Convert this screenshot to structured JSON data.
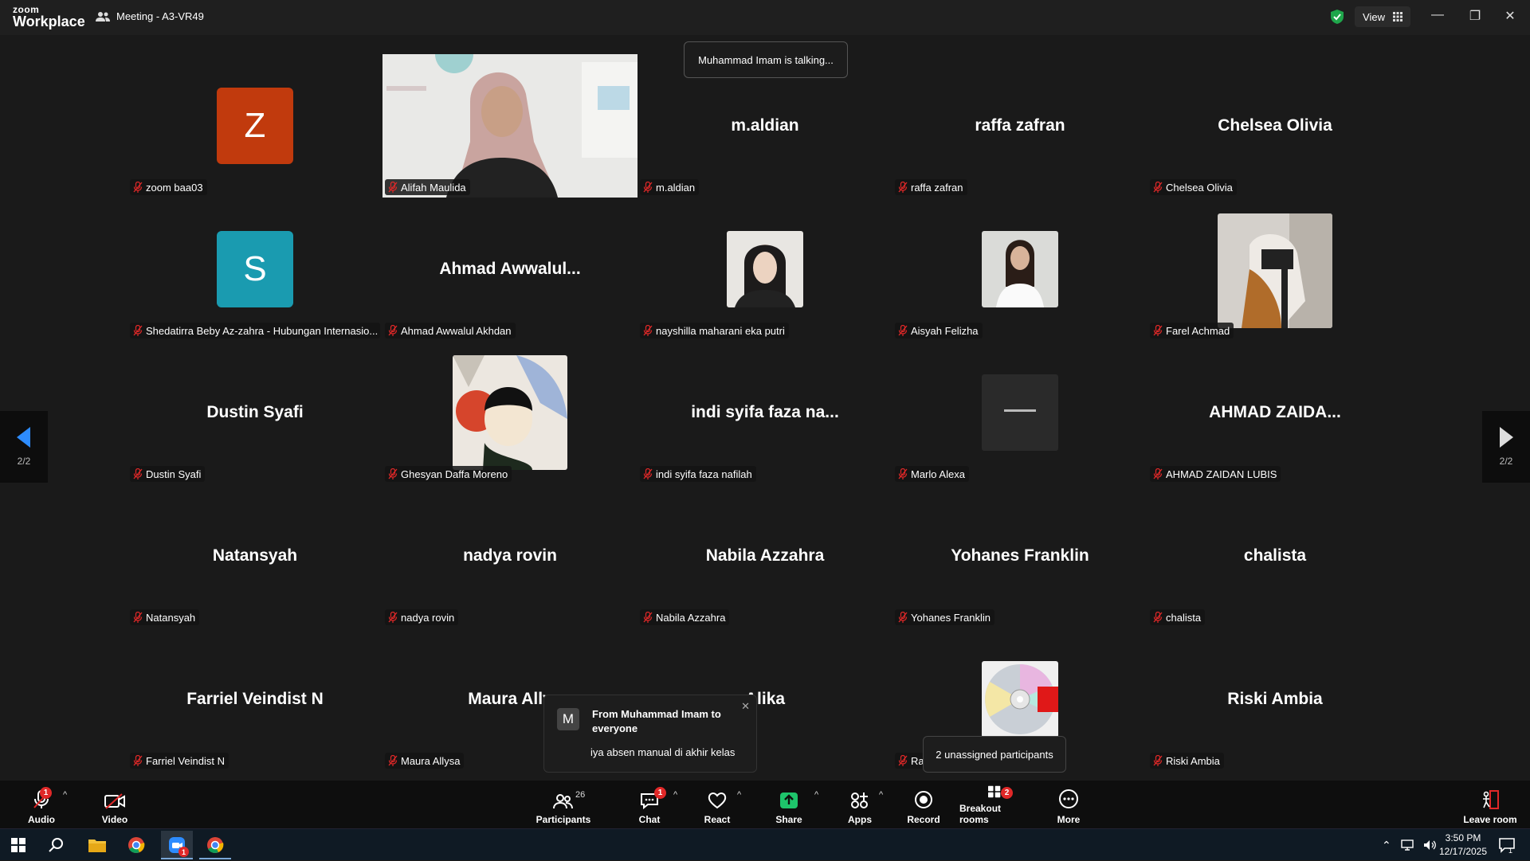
{
  "titlebar": {
    "logo_line1": "zoom",
    "logo_line2": "Workplace",
    "meeting_title": "Meeting - A3-VR49",
    "view_label": "View"
  },
  "talking_indicator": "Muhammad Imam is talking...",
  "pager": {
    "left_page": "2/2",
    "right_page": "2/2"
  },
  "tiles": [
    {
      "row": 0,
      "col": 0,
      "label": "zoom baa03",
      "kind": "avatar",
      "letter": "Z",
      "color": "#c13a0d"
    },
    {
      "row": 0,
      "col": 1,
      "label": "Alifah Maulida",
      "kind": "video"
    },
    {
      "row": 0,
      "col": 2,
      "label": "m.aldian",
      "kind": "name",
      "center": "m.aldian"
    },
    {
      "row": 0,
      "col": 3,
      "label": "raffa zafran",
      "kind": "name",
      "center": "raffa zafran"
    },
    {
      "row": 0,
      "col": 4,
      "label": "Chelsea Olivia",
      "kind": "name",
      "center": "Chelsea Olivia"
    },
    {
      "row": 1,
      "col": 0,
      "label": "Shedatirra Beby Az-zahra - Hubungan Internasio...",
      "kind": "avatar",
      "letter": "S",
      "color": "#1a9bb0"
    },
    {
      "row": 1,
      "col": 1,
      "label": "Ahmad Awwalul Akhdan",
      "kind": "name",
      "center": "Ahmad  Awwalul..."
    },
    {
      "row": 1,
      "col": 2,
      "label": "nayshilla maharani eka putri",
      "kind": "photo"
    },
    {
      "row": 1,
      "col": 3,
      "label": "Aisyah Felizha",
      "kind": "photo"
    },
    {
      "row": 1,
      "col": 4,
      "label": "Farel Achmad",
      "kind": "photo"
    },
    {
      "row": 2,
      "col": 0,
      "label": "Dustin Syafi",
      "kind": "name",
      "center": "Dustin Syafi"
    },
    {
      "row": 2,
      "col": 1,
      "label": "Ghesyan Daffa Moreno",
      "kind": "photo"
    },
    {
      "row": 2,
      "col": 2,
      "label": "indi syifa faza nafilah",
      "kind": "name",
      "center": "indi syifa faza na..."
    },
    {
      "row": 2,
      "col": 3,
      "label": "Marlo Alexa",
      "kind": "photo"
    },
    {
      "row": 2,
      "col": 4,
      "label": "AHMAD ZAIDAN LUBIS",
      "kind": "name",
      "center": "AHMAD  ZAIDA..."
    },
    {
      "row": 3,
      "col": 0,
      "label": "Natansyah",
      "kind": "name",
      "center": "Natansyah"
    },
    {
      "row": 3,
      "col": 1,
      "label": "nadya rovin",
      "kind": "name",
      "center": "nadya rovin"
    },
    {
      "row": 3,
      "col": 2,
      "label": "Nabila Azzahra",
      "kind": "name",
      "center": "Nabila Azzahra"
    },
    {
      "row": 3,
      "col": 3,
      "label": "Yohanes Franklin",
      "kind": "name",
      "center": "Yohanes Franklin"
    },
    {
      "row": 3,
      "col": 4,
      "label": "chalista",
      "kind": "name",
      "center": "chalista"
    },
    {
      "row": 4,
      "col": 0,
      "label": "Farriel Veindist N",
      "kind": "name",
      "center": "Farriel Veindist N"
    },
    {
      "row": 4,
      "col": 1,
      "label": "Maura Allysa",
      "kind": "name",
      "center": "Maura Ally"
    },
    {
      "row": 4,
      "col": 2,
      "label": "",
      "kind": "name",
      "center": "Alika"
    },
    {
      "row": 4,
      "col": 3,
      "label": "Ra",
      "kind": "photo"
    },
    {
      "row": 4,
      "col": 4,
      "label": "Riski Ambia",
      "kind": "name",
      "center": "Riski Ambia"
    }
  ],
  "chat_toast": {
    "avatar_letter": "M",
    "from": "From Muhammad Imam to everyone",
    "message": "iya absen manual di akhir kelas"
  },
  "unassigned_tooltip": "2 unassigned participants",
  "toolbar": {
    "audio": "Audio",
    "video": "Video",
    "participants": "Participants",
    "participants_count": "26",
    "chat": "Chat",
    "chat_badge": "1",
    "react": "React",
    "share": "Share",
    "apps": "Apps",
    "record": "Record",
    "breakout": "Breakout rooms",
    "breakout_badge": "2",
    "more": "More",
    "leave": "Leave room",
    "audio_badge": "1"
  },
  "taskbar": {
    "time": "3:50 PM",
    "date": "12/17/2025",
    "notif_count": "1",
    "zoom_badge": "1"
  },
  "colors": {
    "accent": "#0e72ed",
    "share_green": "#1ec46b",
    "danger": "#e02828"
  }
}
